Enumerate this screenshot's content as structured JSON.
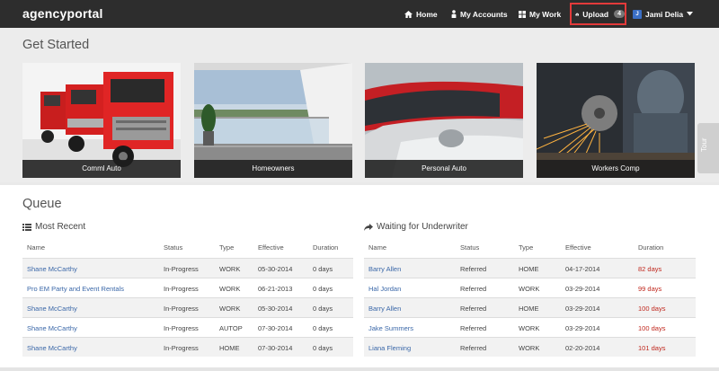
{
  "brand": "agencyportal",
  "nav": {
    "home": "Home",
    "accounts": "My Accounts",
    "work": "My Work",
    "upload": "Upload",
    "upload_count": "4",
    "user_initial": "J",
    "user": "Jami Delia"
  },
  "get_started": {
    "title": "Get Started",
    "cards": [
      "Comml Auto",
      "Homeowners",
      "Personal Auto",
      "Workers Comp"
    ]
  },
  "tour": "Tour",
  "queue": {
    "title": "Queue",
    "most_recent": {
      "title": "Most Recent",
      "columns": [
        "Name",
        "Status",
        "Type",
        "Effective",
        "Duration"
      ],
      "rows": [
        [
          "Shane McCarthy",
          "In-Progress",
          "WORK",
          "05-30-2014",
          "0 days"
        ],
        [
          "Pro EM Party and Event Rentals",
          "In-Progress",
          "WORK",
          "06-21-2013",
          "0 days"
        ],
        [
          "Shane McCarthy",
          "In-Progress",
          "WORK",
          "05-30-2014",
          "0 days"
        ],
        [
          "Shane McCarthy",
          "In-Progress",
          "AUTOP",
          "07-30-2014",
          "0 days"
        ],
        [
          "Shane McCarthy",
          "In-Progress",
          "HOME",
          "07-30-2014",
          "0 days"
        ]
      ]
    },
    "waiting": {
      "title": "Waiting for Underwriter",
      "columns": [
        "Name",
        "Status",
        "Type",
        "Effective",
        "Duration"
      ],
      "rows": [
        [
          "Barry Allen",
          "Referred",
          "HOME",
          "04-17-2014",
          "82 days"
        ],
        [
          "Hal Jordan",
          "Referred",
          "WORK",
          "03-29-2014",
          "99 days"
        ],
        [
          "Barry Allen",
          "Referred",
          "HOME",
          "03-29-2014",
          "100 days"
        ],
        [
          "Jake Summers",
          "Referred",
          "WORK",
          "03-29-2014",
          "100 days"
        ],
        [
          "Liana Fleming",
          "Referred",
          "WORK",
          "02-20-2014",
          "101 days"
        ]
      ]
    }
  },
  "colors": {
    "nav_bg": "#2d2d2d",
    "highlight": "#e33a3a",
    "link": "#3a67a8",
    "overdue": "#c0281e"
  }
}
